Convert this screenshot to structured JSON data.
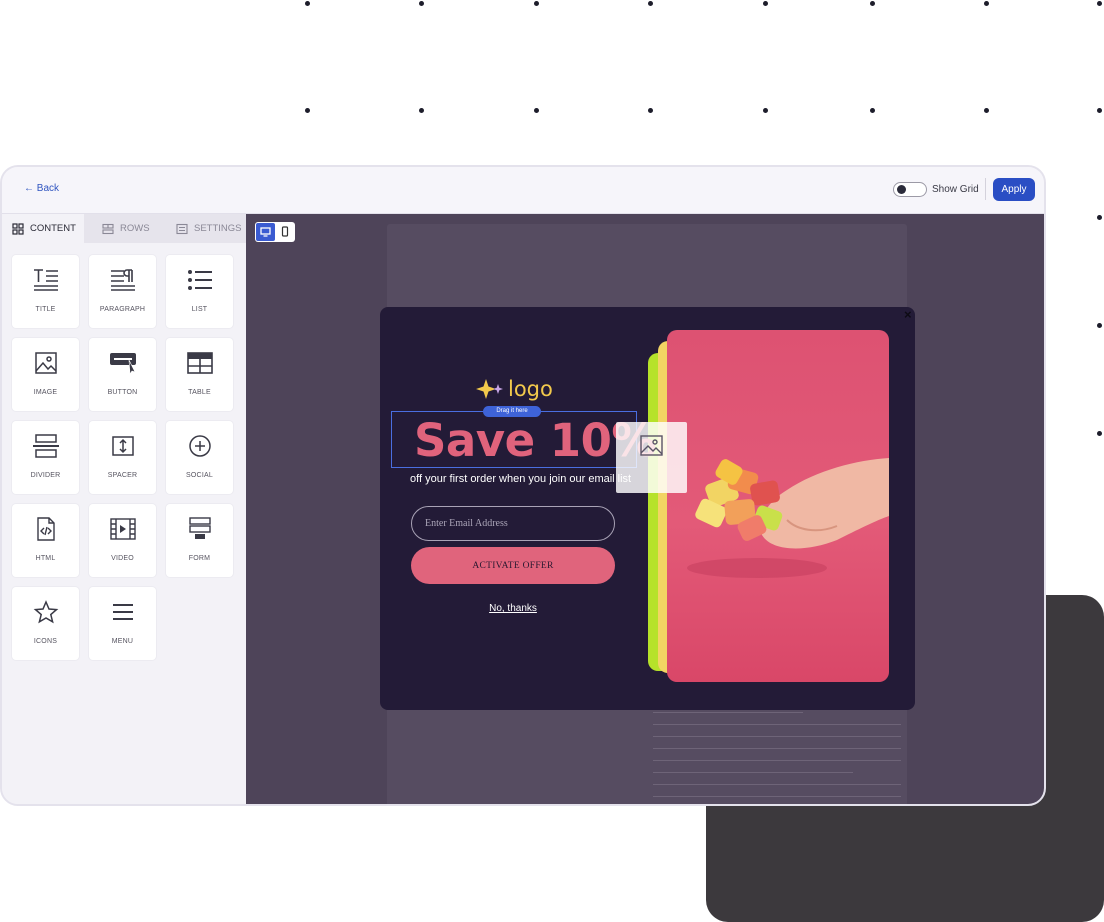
{
  "topbar": {
    "back_label": "Back",
    "show_grid_label": "Show Grid",
    "apply_label": "Apply"
  },
  "tabs": [
    {
      "label": "CONTENT",
      "icon": "grid-icon"
    },
    {
      "label": "ROWS",
      "icon": "rows-icon"
    },
    {
      "label": "SETTINGS",
      "icon": "settings-icon"
    }
  ],
  "blocks": [
    {
      "label": "TITLE",
      "icon": "title-icon"
    },
    {
      "label": "PARAGRAPH",
      "icon": "paragraph-icon"
    },
    {
      "label": "LIST",
      "icon": "list-icon"
    },
    {
      "label": "IMAGE",
      "icon": "image-icon"
    },
    {
      "label": "BUTTON",
      "icon": "button-icon"
    },
    {
      "label": "TABLE",
      "icon": "table-icon"
    },
    {
      "label": "DIVIDER",
      "icon": "divider-icon"
    },
    {
      "label": "SPACER",
      "icon": "spacer-icon"
    },
    {
      "label": "SOCIAL",
      "icon": "social-icon"
    },
    {
      "label": "HTML",
      "icon": "html-icon"
    },
    {
      "label": "VIDEO",
      "icon": "video-icon"
    },
    {
      "label": "FORM",
      "icon": "form-icon"
    },
    {
      "label": "ICONS",
      "icon": "star-icon"
    },
    {
      "label": "MENU",
      "icon": "menu-icon"
    }
  ],
  "popup": {
    "logo_text": "logo",
    "drag_hint": "Drag it here",
    "headline": "Save 10%",
    "subline": "off your first order when you join our email list",
    "email_placeholder": "Enter Email Address",
    "cta_label": "ACTIVATE OFFER",
    "decline_label": "No, thanks",
    "close_label": "×"
  },
  "colors": {
    "accent": "#2a4ec4",
    "canvas_bg": "#4e4459",
    "popup_bg": "#231b37",
    "headline": "#e0637c",
    "cta": "#e0647c",
    "logo": "#f2c94c"
  }
}
